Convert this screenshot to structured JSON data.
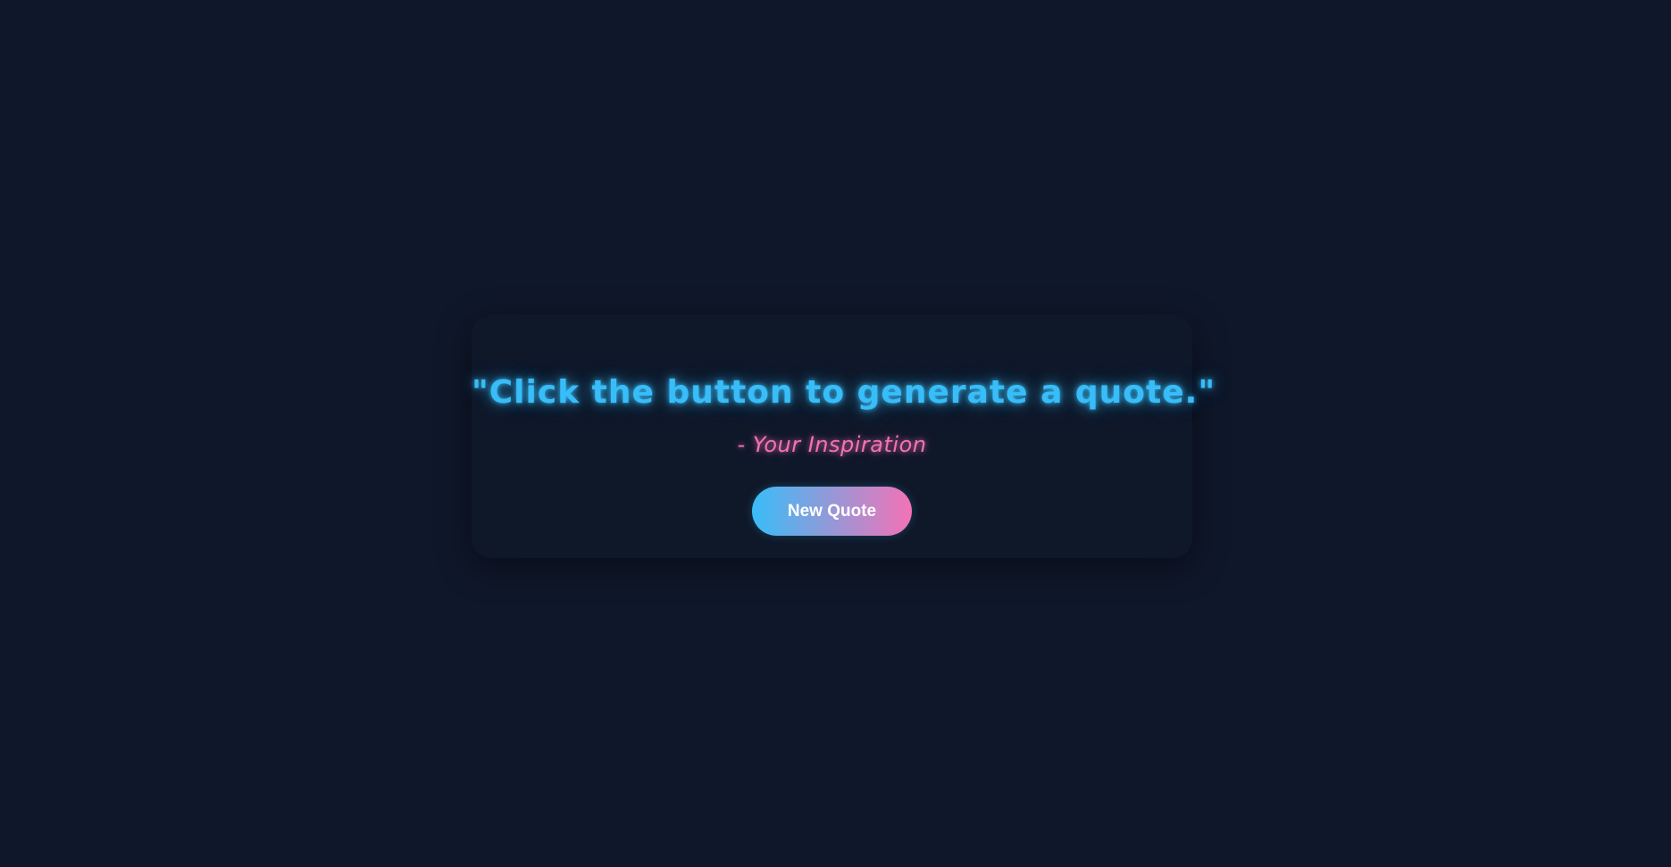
{
  "quote": {
    "text": "\"Click the button to generate a quote.\"",
    "author": "- Your Inspiration"
  },
  "actions": {
    "new_quote_label": "New Quote"
  },
  "colors": {
    "background": "#0f172a",
    "card": "#0f1829",
    "quote_text": "#38bdf8",
    "author_text": "#f472b6",
    "button_gradient_start": "#38bdf8",
    "button_gradient_end": "#f472b6"
  }
}
